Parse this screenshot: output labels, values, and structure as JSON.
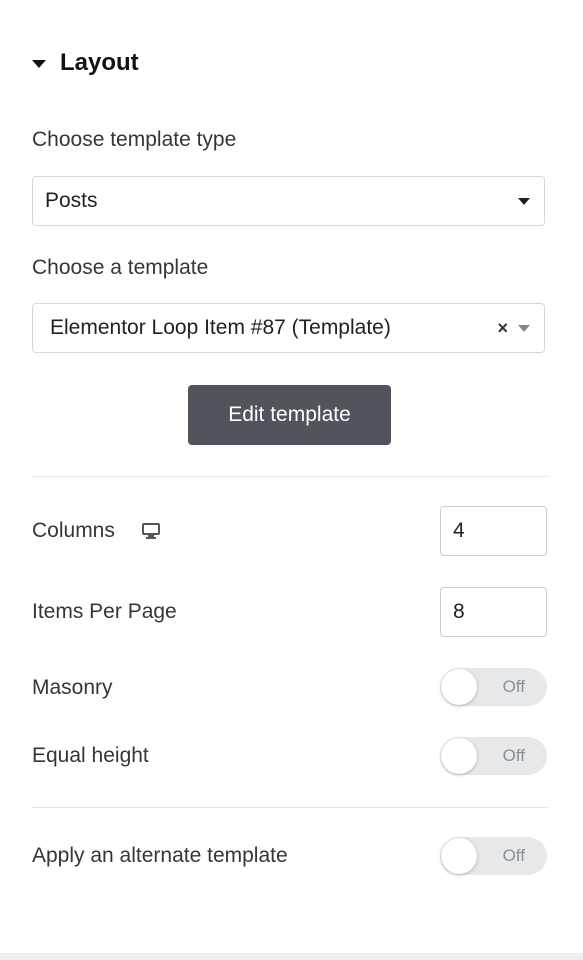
{
  "section": {
    "title": "Layout"
  },
  "template_type": {
    "label": "Choose template type",
    "selected": "Posts"
  },
  "template": {
    "label": "Choose a template",
    "selected": "Elementor Loop Item #87 (Template)",
    "clear_symbol": "×"
  },
  "edit_button": {
    "label": "Edit template"
  },
  "columns": {
    "label": "Columns",
    "value": "4"
  },
  "items_per_page": {
    "label": "Items Per Page",
    "value": "8"
  },
  "masonry": {
    "label": "Masonry",
    "state": "Off"
  },
  "equal_height": {
    "label": "Equal height",
    "state": "Off"
  },
  "alternate_template": {
    "label": "Apply an alternate template",
    "state": "Off"
  },
  "icons": {
    "section_caret": "caret-down-icon",
    "device": "desktop-monitor-icon",
    "select_arrow": "chevron-down-icon",
    "clear": "clear-x-icon"
  },
  "colors": {
    "button_bg": "#51555b",
    "toggle_off_bg": "#e6e8ea",
    "text": "#33363a"
  }
}
